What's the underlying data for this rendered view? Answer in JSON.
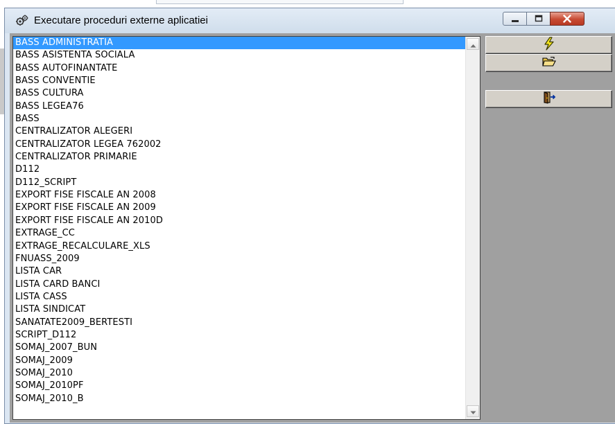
{
  "window": {
    "title": "Executare proceduri externe aplicatiei"
  },
  "titlebar_icons": {
    "app": "gears-icon",
    "minimize": "minimize-icon",
    "maximize": "maximize-icon",
    "close": "close-icon"
  },
  "list": {
    "selected_index": 0,
    "items": [
      "BASS ADMINISTRATIA",
      "BASS ASISTENTA SOCIALA",
      "BASS AUTOFINANTATE",
      "BASS CONVENTIE",
      "BASS CULTURA",
      "BASS LEGEA76",
      "BASS",
      "CENTRALIZATOR ALEGERI",
      "CENTRALIZATOR LEGEA 762002",
      "CENTRALIZATOR PRIMARIE",
      "D112",
      "D112_SCRIPT",
      "EXPORT FISE FISCALE AN 2008",
      "EXPORT FISE FISCALE AN 2009",
      "EXPORT FISE FISCALE AN 2010D",
      "EXTRAGE_CC",
      "EXTRAGE_RECALCULARE_XLS",
      "FNUASS_2009",
      "LISTA CAR",
      "LISTA CARD BANCI",
      "LISTA CASS",
      "LISTA SINDICAT",
      "SANATATE2009_BERTESTI",
      "SCRIPT_D112",
      "SOMAJ_2007_BUN",
      "SOMAJ_2009",
      "SOMAJ_2010",
      "SOMAJ_2010PF",
      "SOMAJ_2010_B"
    ]
  },
  "toolbar": {
    "run_icon": "lightning-icon",
    "open_icon": "open-folder-icon",
    "exit_icon": "exit-door-icon"
  },
  "colors": {
    "selection": "#3399ff",
    "client_background": "#a0a0a0",
    "close_button": "#c74a32",
    "lightning": "#f5e61e",
    "folder": "#f2d36b"
  }
}
